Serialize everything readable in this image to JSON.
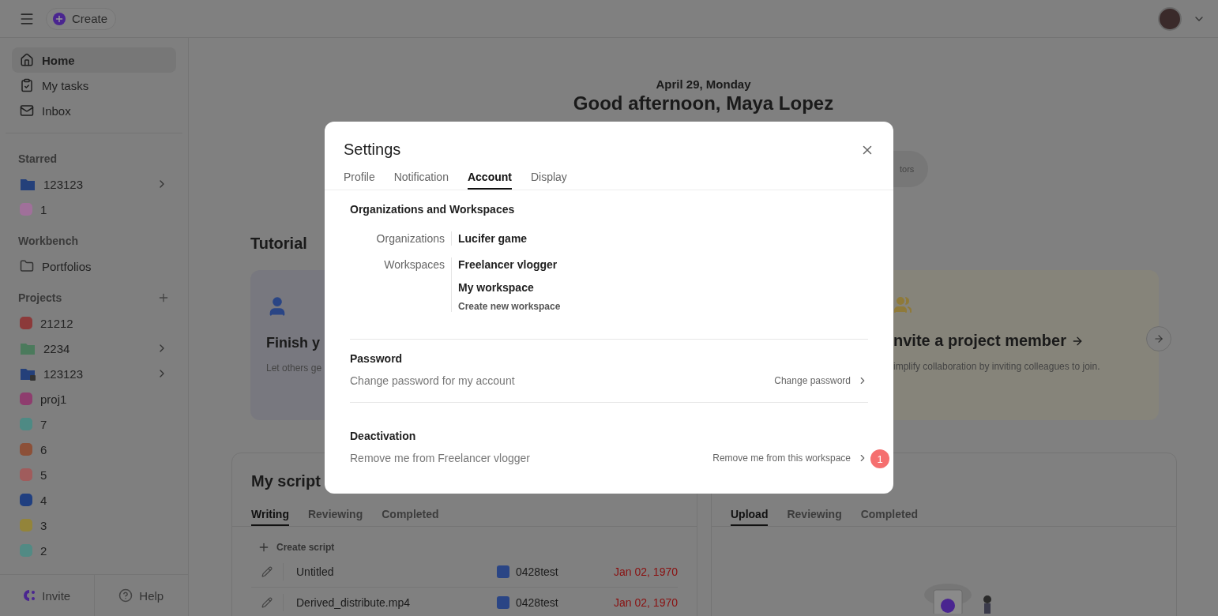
{
  "topbar": {
    "create_label": "Create"
  },
  "sidebar": {
    "nav": [
      {
        "label": "Home",
        "kind": "home",
        "selected": true
      },
      {
        "label": "My tasks",
        "kind": "tasks",
        "selected": false
      },
      {
        "label": "Inbox",
        "kind": "inbox",
        "selected": false
      }
    ],
    "sections": [
      {
        "title": "Starred",
        "add": false,
        "items": [
          {
            "label": "123123",
            "kind": "folder",
            "color": "#24407a",
            "expandable": true,
            "locked": false
          },
          {
            "label": "1",
            "kind": "dot",
            "color": "#a0709a",
            "expandable": false,
            "locked": false
          }
        ]
      },
      {
        "title": "Workbench",
        "add": false,
        "items": [
          {
            "label": "Portfolios",
            "kind": "outline",
            "expandable": false,
            "locked": false
          }
        ]
      },
      {
        "title": "Projects",
        "add": true,
        "items": [
          {
            "label": "21212",
            "kind": "dot",
            "color": "#8c3a3a",
            "expandable": false,
            "locked": false
          },
          {
            "label": "2234",
            "kind": "folder",
            "color": "#4b7a5c",
            "expandable": true,
            "locked": false
          },
          {
            "label": "123123",
            "kind": "folder",
            "color": "#24407a",
            "expandable": true,
            "locked": true
          },
          {
            "label": "proj1",
            "kind": "dot",
            "color": "#8e3d6e",
            "expandable": false,
            "locked": false
          },
          {
            "label": "7",
            "kind": "dot",
            "color": "#4e8a84",
            "expandable": false,
            "locked": false
          },
          {
            "label": "6",
            "kind": "dot",
            "color": "#8c5038",
            "expandable": false,
            "locked": false
          },
          {
            "label": "5",
            "kind": "dot",
            "color": "#a05c5c",
            "expandable": false,
            "locked": false
          },
          {
            "label": "4",
            "kind": "dot",
            "color": "#203f80",
            "expandable": false,
            "locked": false
          },
          {
            "label": "3",
            "kind": "dot",
            "color": "#93843a",
            "expandable": false,
            "locked": false
          },
          {
            "label": "2",
            "kind": "dot",
            "color": "#528a84",
            "expandable": false,
            "locked": false
          }
        ]
      }
    ],
    "footer": [
      {
        "label": "Invite",
        "kind": "invite"
      },
      {
        "label": "Help",
        "kind": "help"
      }
    ]
  },
  "main": {
    "date": "April 29, Monday",
    "greeting": "Good afternoon, Maya Lopez",
    "pill_label": "tors",
    "tutorial": {
      "title": "Tutorial",
      "cards": [
        {
          "kind": "profile",
          "title": "Finish y",
          "text": "Let others ge"
        },
        {
          "kind": "invite",
          "title": "nvite a project member",
          "text": "implify collaboration by inviting colleagues to join."
        }
      ]
    },
    "panels": [
      {
        "title": "My script",
        "tabs": [
          {
            "label": "Writing",
            "selected": true
          },
          {
            "label": "Reviewing",
            "selected": false
          },
          {
            "label": "Completed",
            "selected": false
          }
        ],
        "create_label": "Create script",
        "rows": [
          {
            "name": "Untitled",
            "project": "0428test",
            "date": "Jan 02, 1970"
          },
          {
            "name": "Derived_distribute.mp4",
            "project": "0428test",
            "date": "Jan 02, 1970"
          }
        ]
      },
      {
        "tabs": [
          {
            "label": "Upload",
            "selected": true
          },
          {
            "label": "Reviewing",
            "selected": false
          },
          {
            "label": "Completed",
            "selected": false
          }
        ],
        "empty": true
      }
    ]
  },
  "dialog": {
    "title": "Settings",
    "tabs": [
      {
        "label": "Profile",
        "selected": false
      },
      {
        "label": "Notification",
        "selected": false
      },
      {
        "label": "Account",
        "selected": true
      },
      {
        "label": "Display",
        "selected": false
      }
    ],
    "org": {
      "title": "Organizations and Workspaces",
      "rows": [
        {
          "label": "Organizations",
          "values": [
            {
              "text": "Lucifer game",
              "kind": "item"
            }
          ]
        },
        {
          "label": "Workspaces",
          "values": [
            {
              "text": "Freelancer vlogger",
              "kind": "item"
            },
            {
              "text": "My workspace",
              "kind": "item"
            },
            {
              "text": "Create new workspace",
              "kind": "action"
            }
          ]
        }
      ]
    },
    "sections": [
      {
        "title": "Password",
        "description": "Change password for my account",
        "action": "Change password"
      },
      {
        "title": "Deactivation",
        "description": "Remove me from Freelancer vlogger",
        "action": "Remove me from this workspace",
        "badge": "1"
      }
    ]
  }
}
